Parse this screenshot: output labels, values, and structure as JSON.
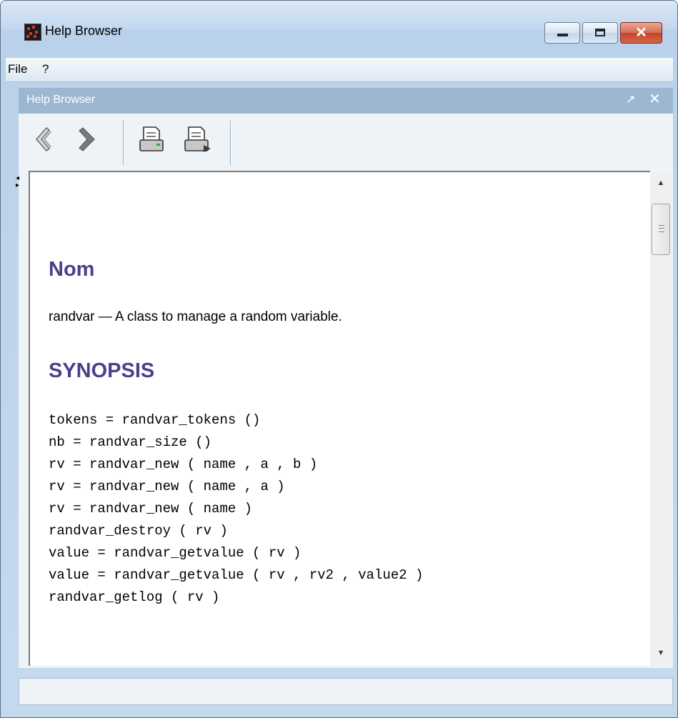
{
  "window": {
    "title": "Help Browser",
    "minimize_label": "–",
    "maximize_label": "□",
    "close_label": "✕"
  },
  "menu": [
    {
      "label": "File"
    },
    {
      "label": "?"
    }
  ],
  "panel": {
    "title": "Help Browser",
    "undock_glyph": "↗",
    "close_glyph": "✕"
  },
  "toolbar": {
    "buttons": [
      "back-icon",
      "forward-icon",
      "print-icon",
      "print-setup-icon"
    ]
  },
  "doc": {
    "heading_name": "Nom",
    "description": "randvar — A class to manage a random variable.",
    "heading_synopsis": "SYNOPSIS",
    "synopsis": [
      "tokens = randvar_tokens ()",
      "nb = randvar_size ()",
      "rv = randvar_new ( name , a , b )",
      "rv = randvar_new ( name , a )",
      "rv = randvar_new ( name )",
      "randvar_destroy ( rv )",
      "value = randvar_getvalue ( rv )",
      "value = randvar_getvalue ( rv , rv2 , value2 )",
      "randvar_getlog ( rv )"
    ]
  },
  "statusbar": {
    "text": ""
  },
  "colors": {
    "heading": "#4c3f8c",
    "panel_bar": "#9db7d3",
    "frame": "#c5d9ee"
  }
}
